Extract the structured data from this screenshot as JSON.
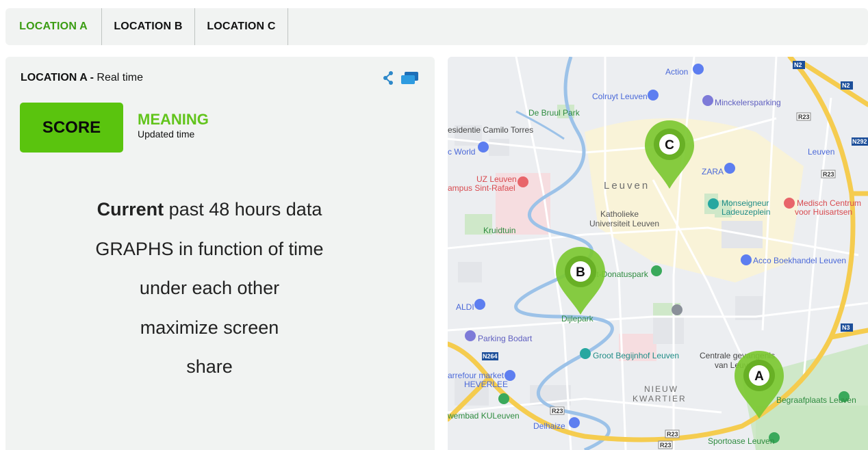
{
  "tabs": [
    {
      "label": "LOCATION A",
      "active": true
    },
    {
      "label": "LOCATION B",
      "active": false
    },
    {
      "label": "LOCATION C",
      "active": false
    }
  ],
  "panel": {
    "title_bold": "LOCATION A -",
    "title_rest": " Real time",
    "icons": [
      "share-icon",
      "chat-icon"
    ],
    "score_label": "SCORE",
    "meaning_title": "MEANING",
    "meaning_sub": "Updated time",
    "line1_bold": "Current",
    "line1_rest": " past 48 hours data",
    "line2": "GRAPHS in function of time",
    "line3": "under each other",
    "line4": "maximize screen",
    "line5": "share"
  },
  "colors": {
    "active_tab": "#3a9c12",
    "score_bg": "#5ac40e",
    "meaning": "#62c41c",
    "pin": "#7cc832"
  },
  "map": {
    "pins": [
      "A",
      "B",
      "C"
    ],
    "city_label": "Leuven",
    "district_label_1": "NIEUW",
    "district_label_2": "KWARTIER",
    "places": [
      "Action",
      "Colruyt Leuven",
      "Minckelersparking",
      "De Bruul Park",
      "esidentie Camilo Torres",
      "c World",
      "Leuven",
      "ZARA",
      "UZ Leuven",
      "ampus Sint-Rafael",
      "Katholieke",
      "Universiteit Leuven",
      "Monseigneur",
      "Ladeuzeplein",
      "Medisch Centrum",
      "voor Huisartsen",
      "Kruidtuin",
      "Sint-Donatuspark",
      "Acco Boekhandel Leuven",
      "ALDI",
      "Dijlepark",
      "Parking Bodart",
      "Groot Begijnhof Leuven",
      "Centrale gevangenis",
      "van Leuven",
      "arrefour market",
      "HEVERLEE",
      "wembad KULeuven",
      "Delhaize",
      "Begraafplaats Leuven",
      "Sportoase Leuven"
    ],
    "road_labels": [
      "N2",
      "N2",
      "N292",
      "R23",
      "R23",
      "R23",
      "R23",
      "N264",
      "N3",
      "R23"
    ]
  }
}
